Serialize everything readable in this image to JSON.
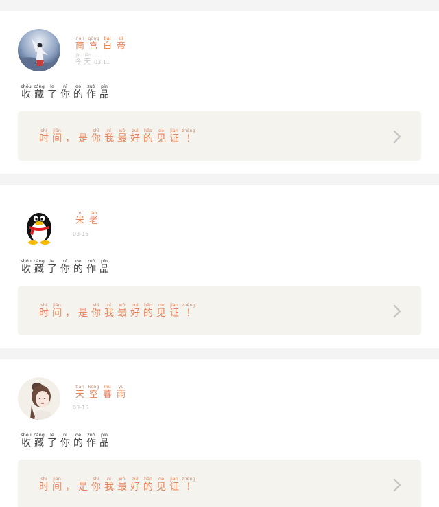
{
  "feed": {
    "items": [
      {
        "username": [
          {
            "py": "nán",
            "hz": "南"
          },
          {
            "py": "gōng",
            "hz": "宫"
          },
          {
            "py": "bái",
            "hz": "白"
          },
          {
            "py": "dì",
            "hz": "帝"
          }
        ],
        "time_label": [
          {
            "py": "jīn",
            "hz": "今"
          },
          {
            "py": "tiān",
            "hz": "天"
          }
        ],
        "time_value": "03:11",
        "avatar_icon": "girl-in-white-robe-avatar-icon",
        "action": [
          {
            "py": "shōu",
            "hz": "收"
          },
          {
            "py": "cáng",
            "hz": "藏"
          },
          {
            "py": "le",
            "hz": "了"
          },
          {
            "py": "nǐ",
            "hz": "你"
          },
          {
            "py": "de",
            "hz": "的"
          },
          {
            "py": "zuò",
            "hz": "作"
          },
          {
            "py": "pǐn",
            "hz": "品"
          }
        ],
        "quote": [
          {
            "py": "shí",
            "hz": "时"
          },
          {
            "py": "jiān",
            "hz": "间"
          },
          {
            "py": "",
            "hz": "，"
          },
          {
            "py": "",
            "hz": "是"
          },
          {
            "py": "shì",
            "hz": "你"
          },
          {
            "py": "nǐ",
            "hz": "我"
          },
          {
            "py": "wǒ",
            "hz": "最"
          },
          {
            "py": "zuì",
            "hz": "好"
          },
          {
            "py": "hǎo",
            "hz": "的"
          },
          {
            "py": "de",
            "hz": "见"
          },
          {
            "py": "jiàn",
            "hz": "证"
          },
          {
            "py": "zhèng",
            "hz": "!"
          }
        ]
      },
      {
        "username": [
          {
            "py": "mǐ",
            "hz": "米"
          },
          {
            "py": "lǎo",
            "hz": "老"
          }
        ],
        "time_label": [],
        "time_value": "03-15",
        "avatar_icon": "qq-penguin-avatar-icon",
        "action": [
          {
            "py": "shōu",
            "hz": "收"
          },
          {
            "py": "cáng",
            "hz": "藏"
          },
          {
            "py": "le",
            "hz": "了"
          },
          {
            "py": "nǐ",
            "hz": "你"
          },
          {
            "py": "de",
            "hz": "的"
          },
          {
            "py": "zuò",
            "hz": "作"
          },
          {
            "py": "pǐn",
            "hz": "品"
          }
        ],
        "quote": [
          {
            "py": "shí",
            "hz": "时"
          },
          {
            "py": "jiān",
            "hz": "间"
          },
          {
            "py": "",
            "hz": "，"
          },
          {
            "py": "",
            "hz": "是"
          },
          {
            "py": "shì",
            "hz": "你"
          },
          {
            "py": "nǐ",
            "hz": "我"
          },
          {
            "py": "wǒ",
            "hz": "最"
          },
          {
            "py": "zuì",
            "hz": "好"
          },
          {
            "py": "hǎo",
            "hz": "的"
          },
          {
            "py": "de",
            "hz": "见"
          },
          {
            "py": "jiàn",
            "hz": "证"
          },
          {
            "py": "zhèng",
            "hz": "!"
          }
        ]
      },
      {
        "username": [
          {
            "py": "tiān",
            "hz": "天"
          },
          {
            "py": "kōng",
            "hz": "空"
          },
          {
            "py": "mù",
            "hz": "暮"
          },
          {
            "py": "yǔ",
            "hz": "雨"
          }
        ],
        "time_label": [],
        "time_value": "03-15",
        "avatar_icon": "girl-portrait-avatar-icon",
        "action": [
          {
            "py": "shōu",
            "hz": "收"
          },
          {
            "py": "cáng",
            "hz": "藏"
          },
          {
            "py": "le",
            "hz": "了"
          },
          {
            "py": "nǐ",
            "hz": "你"
          },
          {
            "py": "de",
            "hz": "的"
          },
          {
            "py": "zuò",
            "hz": "作"
          },
          {
            "py": "pǐn",
            "hz": "品"
          }
        ],
        "quote": [
          {
            "py": "shí",
            "hz": "时"
          },
          {
            "py": "jiān",
            "hz": "间"
          },
          {
            "py": "",
            "hz": "，"
          },
          {
            "py": "",
            "hz": "是"
          },
          {
            "py": "shì",
            "hz": "你"
          },
          {
            "py": "nǐ",
            "hz": "我"
          },
          {
            "py": "wǒ",
            "hz": "最"
          },
          {
            "py": "zuì",
            "hz": "好"
          },
          {
            "py": "hǎo",
            "hz": "的"
          },
          {
            "py": "de",
            "hz": "见"
          },
          {
            "py": "jiàn",
            "hz": "证"
          },
          {
            "py": "zhèng",
            "hz": "!"
          }
        ]
      }
    ]
  },
  "colors": {
    "accent": "#e6845c",
    "page_background": "#f4f4f4",
    "quote_background": "#f4f3ee",
    "muted_text": "#c4c4c4"
  },
  "icons": {
    "chevron": "chevron-right-icon"
  }
}
